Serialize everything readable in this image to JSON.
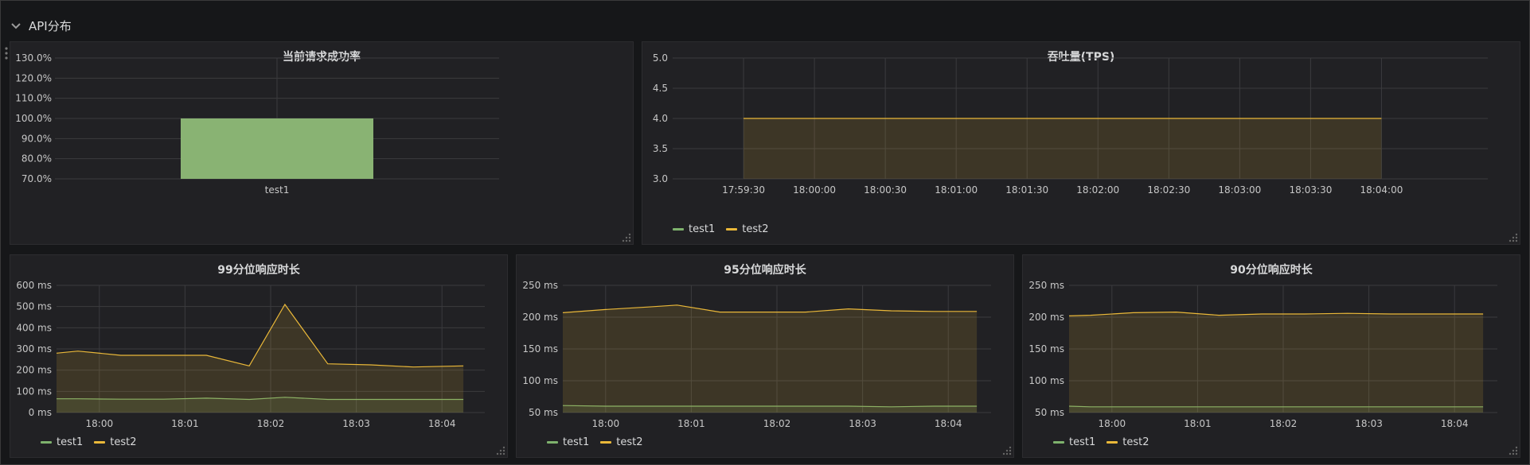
{
  "row": {
    "title": "API分布"
  },
  "colors": {
    "background": "#161719",
    "panel": "#212124",
    "grid": "#3b3b3e",
    "test1": "#7eb26d",
    "test2": "#eab839",
    "bar_fill": "#89b373",
    "area_fill": "#3b3a2c"
  },
  "panels": {
    "success": {
      "title": "当前请求成功率",
      "chart_data": {
        "type": "bar",
        "categories": [
          "test1"
        ],
        "values": [
          100.0
        ],
        "ylim": [
          70,
          130
        ],
        "yticks": [
          "70.0%",
          "80.0%",
          "90.0%",
          "100.0%",
          "110.0%",
          "120.0%",
          "130.0%"
        ],
        "grid": true
      }
    },
    "tps": {
      "title": "吞吐量(TPS)",
      "legend": [
        "test1",
        "test2"
      ],
      "chart_data": {
        "type": "area",
        "x": [
          "17:59:30",
          "18:00:00",
          "18:00:30",
          "18:01:00",
          "18:01:30",
          "18:02:00",
          "18:02:30",
          "18:03:00",
          "18:03:30",
          "18:04:00"
        ],
        "xticks": [
          "17:59:30",
          "18:00:00",
          "18:00:30",
          "18:01:00",
          "18:01:30",
          "18:02:00",
          "18:02:30",
          "18:03:00",
          "18:03:30",
          "18:04:00"
        ],
        "yticks": [
          "3.0",
          "3.5",
          "4.0",
          "4.5",
          "5.0"
        ],
        "ylim": [
          3,
          5
        ],
        "series": [
          {
            "name": "test2",
            "values": [
              4,
              4,
              4,
              4,
              4,
              4,
              4,
              4,
              4,
              4
            ]
          }
        ],
        "grid": true,
        "legend_position": "bottom-left"
      }
    },
    "p99": {
      "title": "99分位响应时长",
      "legend": [
        "test1",
        "test2"
      ],
      "chart_data": {
        "type": "line",
        "x": [
          "17:59:30",
          "17:59:45",
          "18:00:15",
          "18:00:45",
          "18:01:15",
          "18:01:45",
          "18:02:10",
          "18:02:40",
          "18:03:10",
          "18:03:40",
          "18:04:15"
        ],
        "xticks": [
          "18:00",
          "18:01",
          "18:02",
          "18:03",
          "18:04"
        ],
        "yticks": [
          "0 ms",
          "100 ms",
          "200 ms",
          "300 ms",
          "400 ms",
          "500 ms",
          "600 ms"
        ],
        "ylim": [
          0,
          600
        ],
        "series": [
          {
            "name": "test1",
            "values": [
              65,
              65,
              63,
              63,
              68,
              62,
              72,
              62,
              62,
              62,
              62
            ]
          },
          {
            "name": "test2",
            "values": [
              280,
              290,
              270,
              270,
              270,
              220,
              510,
              230,
              225,
              215,
              220
            ]
          }
        ],
        "grid": true,
        "legend_position": "bottom-left"
      }
    },
    "p95": {
      "title": "95分位响应时长",
      "legend": [
        "test1",
        "test2"
      ],
      "chart_data": {
        "type": "line",
        "x": [
          "17:59:30",
          "18:00:00",
          "18:00:30",
          "18:00:50",
          "18:01:20",
          "18:01:50",
          "18:02:20",
          "18:02:50",
          "18:03:20",
          "18:03:50",
          "18:04:20"
        ],
        "xticks": [
          "18:00",
          "18:01",
          "18:02",
          "18:03",
          "18:04"
        ],
        "yticks": [
          "50 ms",
          "100 ms",
          "150 ms",
          "200 ms",
          "250 ms"
        ],
        "ylim": [
          50,
          250
        ],
        "series": [
          {
            "name": "test1",
            "values": [
              61,
              60,
              60,
              60,
              60,
              60,
              60,
              60,
              59,
              60,
              60
            ]
          },
          {
            "name": "test2",
            "values": [
              207,
              212,
              216,
              219,
              208,
              208,
              208,
              213,
              210,
              209,
              209
            ]
          }
        ],
        "grid": true,
        "legend_position": "bottom-left"
      }
    },
    "p90": {
      "title": "90分位响应时长",
      "legend": [
        "test1",
        "test2"
      ],
      "chart_data": {
        "type": "line",
        "x": [
          "17:59:30",
          "17:59:45",
          "18:00:15",
          "18:00:45",
          "18:01:15",
          "18:01:45",
          "18:02:15",
          "18:02:45",
          "18:03:15",
          "18:03:45",
          "18:04:20"
        ],
        "xticks": [
          "18:00",
          "18:01",
          "18:02",
          "18:03",
          "18:04"
        ],
        "yticks": [
          "50 ms",
          "100 ms",
          "150 ms",
          "200 ms",
          "250 ms"
        ],
        "ylim": [
          50,
          250
        ],
        "series": [
          {
            "name": "test1",
            "values": [
              60,
              59,
              59,
              59,
              59,
              59,
              59,
              59,
              59,
              59,
              59
            ]
          },
          {
            "name": "test2",
            "values": [
              202,
              203,
              207,
              208,
              203,
              205,
              205,
              206,
              205,
              205,
              205
            ]
          }
        ],
        "grid": true,
        "legend_position": "bottom-left"
      }
    }
  }
}
